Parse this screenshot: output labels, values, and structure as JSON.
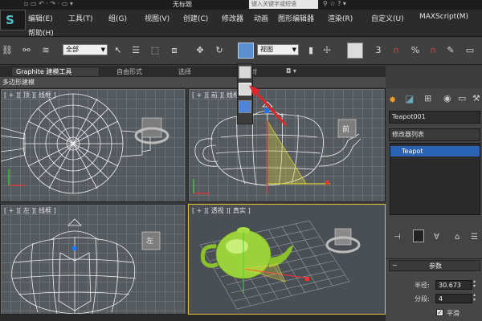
{
  "window": {
    "title": "无标题"
  },
  "search": {
    "placeholder": "键入关键字或短语"
  },
  "logo": {
    "glyph": "S"
  },
  "menu": {
    "items": [
      "编辑(E)",
      "工具(T)",
      "组(G)",
      "视图(V)",
      "创建(C)",
      "修改器",
      "动画",
      "图形编辑器",
      "渲染(R)",
      "自定义(U)",
      "MAXScript(M)"
    ],
    "help": "帮助(H)"
  },
  "toolbar": {
    "filter_select": "全部",
    "view_select": "视图",
    "numeric_glyph": "3",
    "percent_glyph": "%"
  },
  "ribbon": {
    "tabs": [
      "Graphite 建模工具",
      "自由形式",
      "选择",
      "对"
    ],
    "sublabel": "多边形建模"
  },
  "viewports": {
    "top_left_label": "[ + ][ 顶 ][ 线框 ]",
    "front_label": "[ + ][ 前 ][ 线框 ]",
    "left_label": "[ + ][ 左 ][ 线框 ]",
    "perspective_label": "[ + ][ 透视 ][ 真实 ]",
    "front_cube_label": "前",
    "left_cube_label": "左"
  },
  "right_panel": {
    "object_name": "Teapot001",
    "modifier_list": "修改器列表",
    "modifier_stack_item": "Teapot",
    "params_title": "参数",
    "radius_label": "半径:",
    "radius_value": "30.673",
    "segments_label": "分段:",
    "segments_value": "4",
    "smooth_label": "平滑",
    "smooth_checked": true
  },
  "colors": {
    "accent_blue": "#2a63b3",
    "active_viewport_border": "#e2c233",
    "annotation_arrow": "#e0262a",
    "teapot_green": "#9bd13a",
    "selection_yellow": "#d9d23a"
  }
}
